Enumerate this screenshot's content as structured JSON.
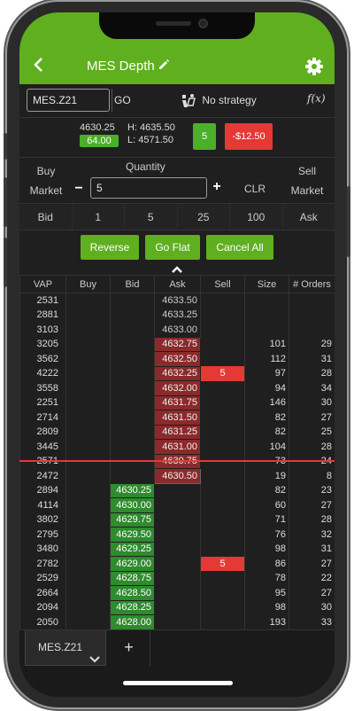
{
  "header": {
    "title": "MES Depth",
    "back_icon": "back-chevron-icon",
    "edit_icon": "pencil-icon",
    "settings_icon": "gear-icon",
    "accent_color": "#5faf1e"
  },
  "toolbar": {
    "symbol_value": "MES.Z21",
    "go_label": "GO",
    "strategy_label": "No strategy",
    "fx_label": "f(x)"
  },
  "quote": {
    "last": "4630.25",
    "change": "64.00",
    "high": "H: 4635.50",
    "low": "L: 4571.50",
    "position": "5",
    "pnl": "-$12.50"
  },
  "order_entry": {
    "buy_label": "Buy",
    "buy_market_label": "Market",
    "quantity_label": "Quantity",
    "quantity_value": "5",
    "minus": "−",
    "plus": "+",
    "clr_label": "CLR",
    "sell_label": "Sell",
    "sell_market_label": "Market"
  },
  "quick_qty": {
    "bid": "Bid",
    "q1": "1",
    "q5": "5",
    "q25": "25",
    "q100": "100",
    "ask": "Ask"
  },
  "actions": {
    "reverse": "Reverse",
    "flat": "Go Flat",
    "cancel_all": "Cancel All"
  },
  "ladder": {
    "headers": [
      "VAP",
      "Buy",
      "Bid",
      "Ask",
      "Sell",
      "Size",
      "# Orders"
    ],
    "rows": [
      {
        "vap": "2531",
        "buy": "",
        "bid": "",
        "ask": "4633.50",
        "sell": "",
        "size": "",
        "orders": "",
        "side": "ask-empty"
      },
      {
        "vap": "2881",
        "buy": "",
        "bid": "",
        "ask": "4633.25",
        "sell": "",
        "size": "",
        "orders": "",
        "side": "ask-empty"
      },
      {
        "vap": "3103",
        "buy": "",
        "bid": "",
        "ask": "4633.00",
        "sell": "",
        "size": "",
        "orders": "",
        "side": "ask-empty"
      },
      {
        "vap": "3205",
        "buy": "",
        "bid": "",
        "ask": "4632.75",
        "sell": "",
        "size": "101",
        "orders": "29",
        "side": "ask"
      },
      {
        "vap": "3562",
        "buy": "",
        "bid": "",
        "ask": "4632.50",
        "sell": "",
        "size": "112",
        "orders": "31",
        "side": "ask"
      },
      {
        "vap": "4222",
        "buy": "",
        "bid": "",
        "ask": "4632.25",
        "sell": "5",
        "size": "97",
        "orders": "28",
        "side": "ask"
      },
      {
        "vap": "3558",
        "buy": "",
        "bid": "",
        "ask": "4632.00",
        "sell": "",
        "size": "94",
        "orders": "34",
        "side": "ask"
      },
      {
        "vap": "2251",
        "buy": "",
        "bid": "",
        "ask": "4631.75",
        "sell": "",
        "size": "146",
        "orders": "30",
        "side": "ask"
      },
      {
        "vap": "2714",
        "buy": "",
        "bid": "",
        "ask": "4631.50",
        "sell": "",
        "size": "82",
        "orders": "27",
        "side": "ask"
      },
      {
        "vap": "2809",
        "buy": "",
        "bid": "",
        "ask": "4631.25",
        "sell": "",
        "size": "82",
        "orders": "25",
        "side": "ask"
      },
      {
        "vap": "3445",
        "buy": "",
        "bid": "",
        "ask": "4631.00",
        "sell": "",
        "size": "104",
        "orders": "28",
        "side": "ask"
      },
      {
        "vap": "2571",
        "buy": "",
        "bid": "",
        "ask": "4630.75",
        "sell": "",
        "size": "73",
        "orders": "24",
        "side": "ask"
      },
      {
        "vap": "2472",
        "buy": "",
        "bid": "",
        "ask": "4630.50",
        "sell": "",
        "size": "19",
        "orders": "8",
        "side": "ask-first"
      },
      {
        "vap": "2894",
        "buy": "",
        "bid": "4630.25",
        "ask": "",
        "sell": "",
        "size": "82",
        "orders": "23",
        "side": "bid-first"
      },
      {
        "vap": "4114",
        "buy": "",
        "bid": "4630.00",
        "ask": "",
        "sell": "",
        "size": "60",
        "orders": "27",
        "side": "bid"
      },
      {
        "vap": "3802",
        "buy": "",
        "bid": "4629.75",
        "ask": "",
        "sell": "",
        "size": "71",
        "orders": "28",
        "side": "bid"
      },
      {
        "vap": "2795",
        "buy": "",
        "bid": "4629.50",
        "ask": "",
        "sell": "",
        "size": "76",
        "orders": "32",
        "side": "bid"
      },
      {
        "vap": "3480",
        "buy": "",
        "bid": "4629.25",
        "ask": "",
        "sell": "",
        "size": "98",
        "orders": "31",
        "side": "bid"
      },
      {
        "vap": "2782",
        "buy": "",
        "bid": "4629.00",
        "ask": "",
        "sell": "5",
        "size": "86",
        "orders": "27",
        "side": "bid"
      },
      {
        "vap": "2529",
        "buy": "",
        "bid": "4628.75",
        "ask": "",
        "sell": "",
        "size": "78",
        "orders": "22",
        "side": "bid"
      },
      {
        "vap": "2664",
        "buy": "",
        "bid": "4628.50",
        "ask": "",
        "sell": "",
        "size": "95",
        "orders": "27",
        "side": "bid"
      },
      {
        "vap": "2094",
        "buy": "",
        "bid": "4628.25",
        "ask": "",
        "sell": "",
        "size": "98",
        "orders": "30",
        "side": "bid"
      },
      {
        "vap": "2050",
        "buy": "",
        "bid": "4628.00",
        "ask": "",
        "sell": "",
        "size": "193",
        "orders": "33",
        "side": "bid"
      }
    ]
  },
  "bottom_tabs": {
    "active_tab": "MES.Z21",
    "add_label": "+"
  },
  "colors": {
    "ask_fill": "#8b2a2a",
    "bid_fill": "#2e8b2e",
    "sell_order": "#e53935",
    "last_trade_line": "#e53935"
  }
}
